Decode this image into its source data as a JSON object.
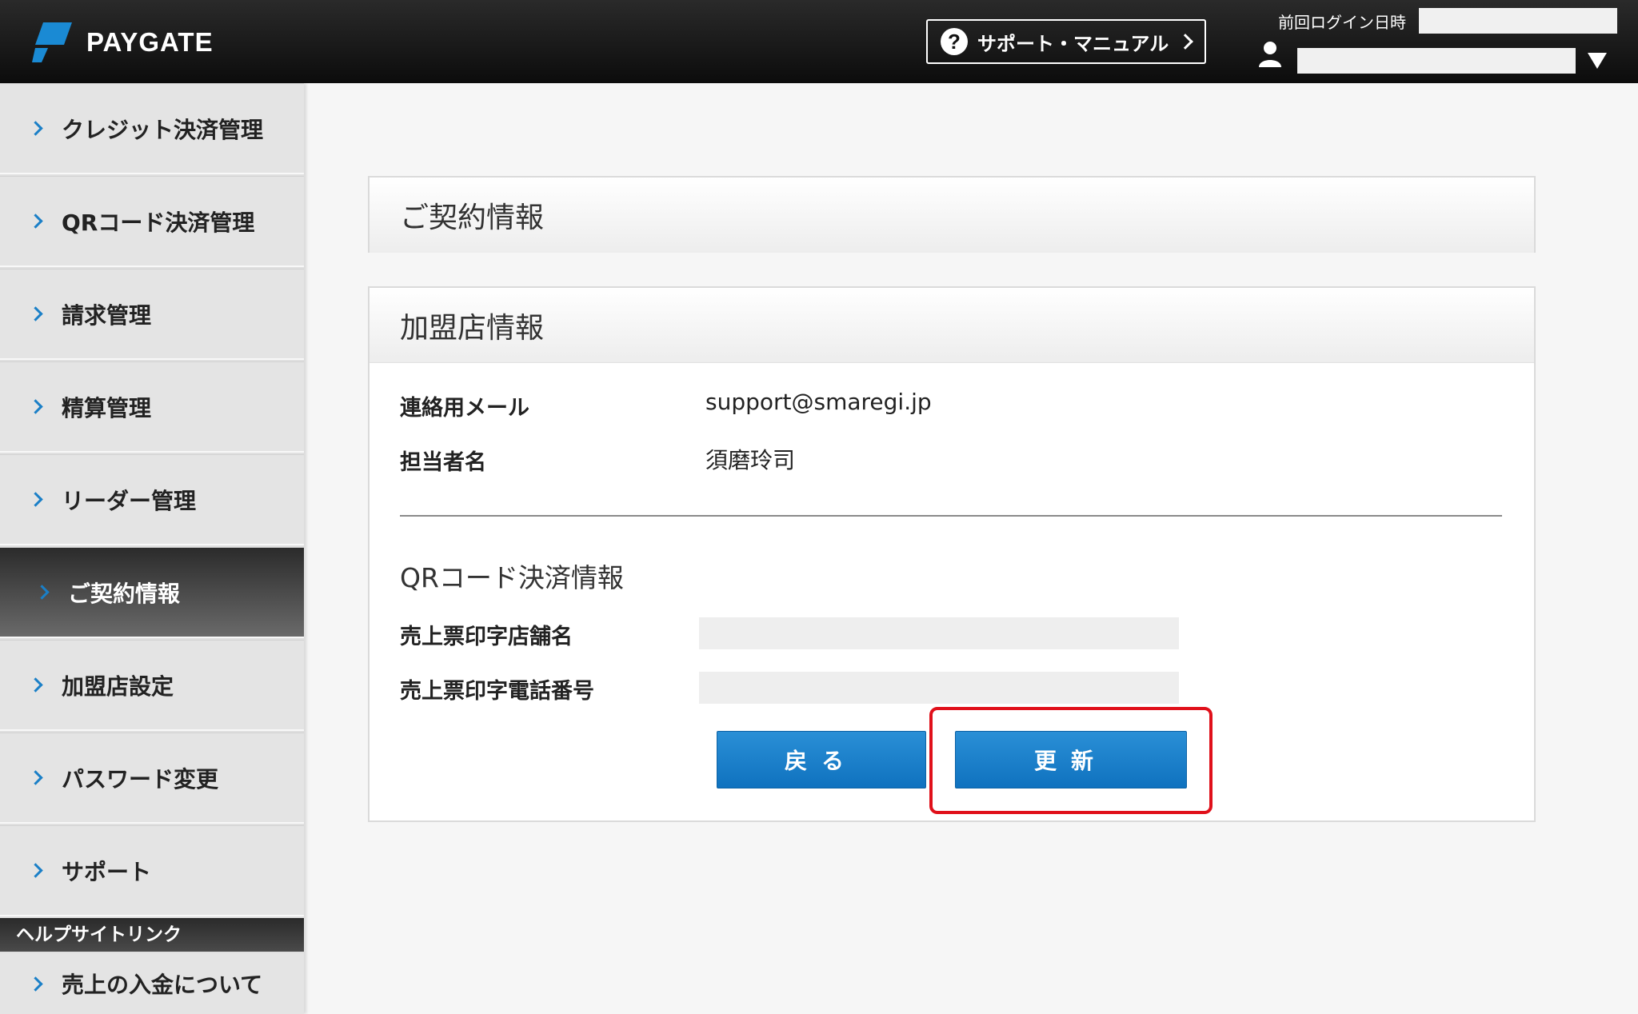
{
  "header": {
    "brand": "PAYGATE",
    "support_label": "サポート・マニュアル",
    "last_login_label": "前回ログイン日時"
  },
  "sidebar": {
    "items": [
      {
        "label": "クレジット決済管理"
      },
      {
        "label": "QRコード決済管理"
      },
      {
        "label": "請求管理"
      },
      {
        "label": "精算管理"
      },
      {
        "label": "リーダー管理"
      },
      {
        "label": "ご契約情報",
        "active": true
      },
      {
        "label": "加盟店設定"
      },
      {
        "label": "パスワード変更"
      },
      {
        "label": "サポート"
      }
    ],
    "help_heading": "ヘルプサイトリンク",
    "help_items": [
      {
        "label": "売上の入金について"
      }
    ]
  },
  "main": {
    "page_title": "ご契約情報",
    "merchant_section": {
      "title": "加盟店情報",
      "rows": [
        {
          "label": "連絡用メール",
          "value": "support@smaregi.jp"
        },
        {
          "label": "担当者名",
          "value": "須磨玲司"
        }
      ]
    },
    "qr_section": {
      "title": "QRコード決済情報",
      "fields": [
        {
          "label": "売上票印字店舗名",
          "value": ""
        },
        {
          "label": "売上票印字電話番号",
          "value": ""
        }
      ]
    },
    "buttons": {
      "back": "戻る",
      "update": "更新"
    }
  },
  "colors": {
    "accent": "#1a7fc7",
    "button": "#1678c2",
    "highlight": "#e0101a",
    "header": "#111111"
  },
  "icons": {
    "logo": "paygate-logo-icon",
    "help": "question-circle-icon",
    "user": "user-icon",
    "dropdown": "triangle-down-icon",
    "nav": "chevron-right-icon"
  }
}
